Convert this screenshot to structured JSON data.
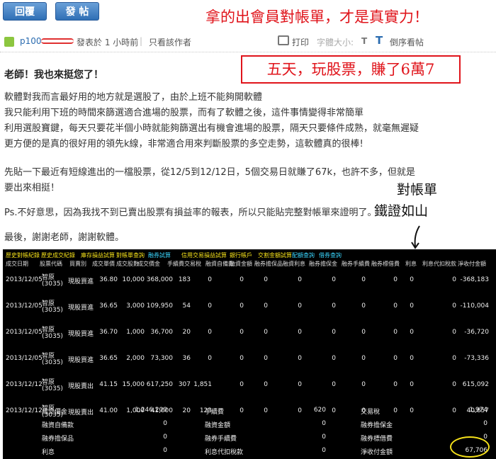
{
  "buttons": {
    "reply": "回覆",
    "post": "發 帖"
  },
  "slogan": "拿的出會員對帳單，才是真實力！",
  "author": {
    "name": "p100",
    "posted": "發表於 1 小時前",
    "only_author": "只看該作者",
    "sep": "|"
  },
  "tools": {
    "print": "打印",
    "font_size": "字體大小:",
    "t_small": "T",
    "t_big": "T",
    "reverse": "倒序看帖"
  },
  "callout": "五天，玩股票，賺了6萬7",
  "post": {
    "title": "老師！我也來挺您了！",
    "p1": [
      "軟體對我而言最好用的地方就是選股了，由於上班不能夠開軟體",
      "我只能利用下班的時間來篩選適合進場的股票，而有了軟體之後，這件事情變得非常簡單",
      "利用選股寶鍵，每天只要花半個小時就能夠篩選出有機會進場的股票，隔天只要條件成熟，就毫無遲疑",
      "更方便的是真的很好用的領先k線，非常適合用來判斷股票的多空走勢，這軟體真的很棒!"
    ],
    "p2": [
      "先貼一下最近有短線進出的一檔股票，從12/5到12/12日，5個交易日就賺了67k，也許不多，但就是",
      "要出來相挺！"
    ],
    "p3": "Ps.不好意思，因為我找不到已賣出股票有損益率的報表，所以只能貼完整對帳單來證明了。",
    "p4": "最後，謝謝老師，謝謝軟體。"
  },
  "evidence": [
    "對帳單",
    "鐵證如山"
  ],
  "statement": {
    "tabs": [
      {
        "label": "歷史對帳紀錄",
        "color": "#f5e11a"
      },
      {
        "label": "歷史成交紀錄",
        "color": "#f5e11a"
      },
      {
        "label": "庫存損益試算",
        "color": "#f5e11a"
      },
      {
        "label": "對帳單查詢",
        "color": "#f5e11a"
      },
      {
        "label": "融券試算",
        "color": "#3ad7ff"
      },
      {
        "label": "信用交易損益試算",
        "color": "#f5e11a"
      },
      {
        "label": "銀行帳戶",
        "color": "#f5e11a"
      },
      {
        "label": "交割金額試算",
        "color": "#f5e11a"
      },
      {
        "label": "配額查詢",
        "color": "#3ad7ff"
      },
      {
        "label": "借券查詢",
        "color": "#3ad7ff"
      }
    ],
    "headers": [
      "成交日期",
      "股票代碼",
      "買賣別",
      "成交單價",
      "成交股數",
      "成交價金",
      "手續費",
      "交易稅",
      "融資自備款",
      "融資金額",
      "融券擔保品",
      "融資利息",
      "融券擔保金",
      "融券手續費",
      "融券標借費",
      "利息",
      "利息代扣稅款",
      "淨收付金額"
    ],
    "rows": [
      {
        "date": "2013/12/05",
        "stock": "智原",
        "code": "(3035)",
        "type": "現股買進",
        "price": "36.80",
        "qty": "10,000",
        "amount": "368,000",
        "fee": "183",
        "tax": "0",
        "c1": "0",
        "c2": "0",
        "c3": "0",
        "c4": "0",
        "c5": "0",
        "c6": "0",
        "c7": "0",
        "c8": "0",
        "net": "-368,183"
      },
      {
        "date": "2013/12/05",
        "stock": "智原",
        "code": "(3035)",
        "type": "現股買進",
        "price": "36.65",
        "qty": "3,000",
        "amount": "109,950",
        "fee": "54",
        "tax": "0",
        "c1": "0",
        "c2": "0",
        "c3": "0",
        "c4": "0",
        "c5": "0",
        "c6": "0",
        "c7": "0",
        "c8": "0",
        "net": "-110,004"
      },
      {
        "date": "2013/12/05",
        "stock": "智原",
        "code": "(3035)",
        "type": "現股買進",
        "price": "36.70",
        "qty": "1,000",
        "amount": "36,700",
        "fee": "20",
        "tax": "0",
        "c1": "0",
        "c2": "0",
        "c3": "0",
        "c4": "0",
        "c5": "0",
        "c6": "0",
        "c7": "0",
        "c8": "0",
        "net": "-36,720"
      },
      {
        "date": "2013/12/05",
        "stock": "智原",
        "code": "(3035)",
        "type": "現股買進",
        "price": "36.65",
        "qty": "2,000",
        "amount": "73,300",
        "fee": "36",
        "tax": "0",
        "c1": "0",
        "c2": "0",
        "c3": "0",
        "c4": "0",
        "c5": "0",
        "c6": "0",
        "c7": "0",
        "c8": "0",
        "net": "-73,336"
      },
      {
        "date": "2013/12/12",
        "stock": "智原",
        "code": "(3035)",
        "type": "現股賣出",
        "price": "41.15",
        "qty": "15,000",
        "amount": "617,250",
        "fee": "307",
        "tax": "1,851",
        "c1": "0",
        "c2": "0",
        "c3": "0",
        "c4": "0",
        "c5": "0",
        "c6": "0",
        "c7": "0",
        "c8": "0",
        "net": "615,092"
      },
      {
        "date": "2013/12/12",
        "stock": "智原",
        "code": "(3035)",
        "type": "現股賣出",
        "price": "41.00",
        "qty": "1,000",
        "amount": "41,000",
        "fee": "20",
        "tax": "123",
        "c1": "0",
        "c2": "0",
        "c3": "0",
        "c4": "0",
        "c5": "0",
        "c6": "0",
        "c7": "0",
        "c8": "0",
        "net": "40,857"
      }
    ],
    "summary": [
      [
        {
          "label": "成交價金",
          "value": "1,246,200"
        },
        {
          "label": "手續費",
          "value": "620"
        },
        {
          "label": "交易稅",
          "value": "1,974"
        }
      ],
      [
        {
          "label": "融資自備款",
          "value": "0"
        },
        {
          "label": "融資金額",
          "value": "0"
        },
        {
          "label": "融券擔保金",
          "value": "0"
        }
      ],
      [
        {
          "label": "融券擔保品",
          "value": "0"
        },
        {
          "label": "融券手續費",
          "value": "0"
        },
        {
          "label": "融券標借費",
          "value": "0"
        }
      ],
      [
        {
          "label": "利息",
          "value": "0"
        },
        {
          "label": "利息代扣稅款",
          "value": "0"
        },
        {
          "label": "淨收付金額",
          "value": "67,706"
        }
      ]
    ]
  }
}
